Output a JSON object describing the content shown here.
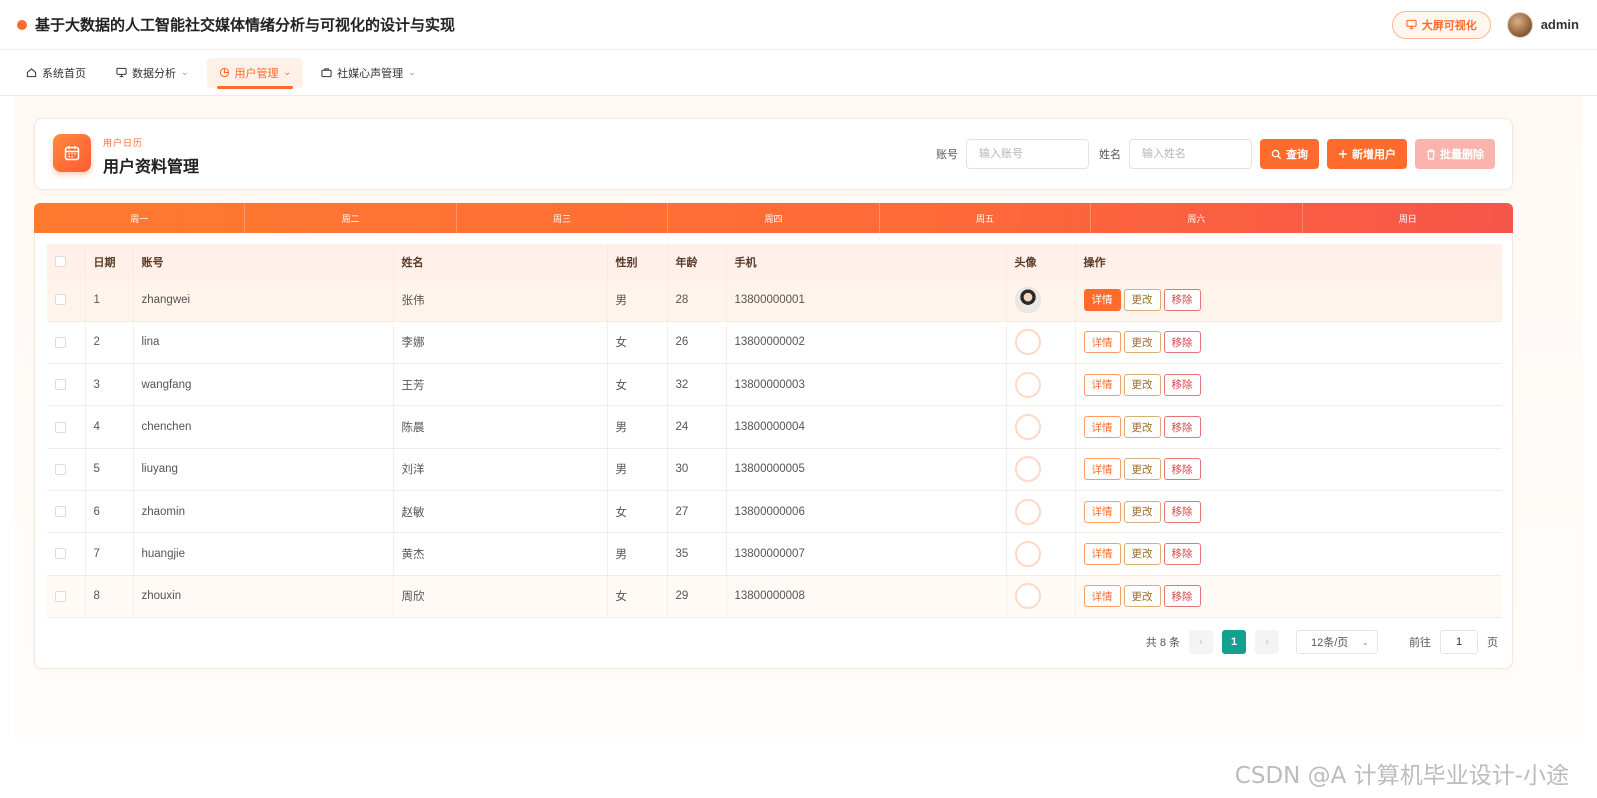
{
  "app": {
    "title": "基于大数据的人工智能社交媒体情绪分析与可视化的设计与实现",
    "bigscreen_label": "大屏可视化",
    "user_name": "admin"
  },
  "nav": {
    "items": [
      {
        "label": "系统首页"
      },
      {
        "label": "数据分析"
      },
      {
        "label": "用户管理"
      },
      {
        "label": "社媒心声管理"
      }
    ]
  },
  "header": {
    "subtitle": "用户日历",
    "title": "用户资料管理"
  },
  "search": {
    "account_label": "账号",
    "account_placeholder": "输入账号",
    "name_label": "姓名",
    "name_placeholder": "输入姓名",
    "query_label": "查询",
    "add_label": "新增用户",
    "batch_delete_label": "批量删除"
  },
  "week": [
    "周一",
    "周二",
    "周三",
    "周四",
    "周五",
    "周六",
    "周日"
  ],
  "table": {
    "columns": [
      "日期",
      "账号",
      "姓名",
      "性别",
      "年龄",
      "手机",
      "头像",
      "操作"
    ],
    "rows": [
      {
        "no": "1",
        "account": "zhangwei",
        "name": "张伟",
        "gender": "男",
        "age": "28",
        "phone": "13800000001"
      },
      {
        "no": "2",
        "account": "lina",
        "name": "李娜",
        "gender": "女",
        "age": "26",
        "phone": "13800000002"
      },
      {
        "no": "3",
        "account": "wangfang",
        "name": "王芳",
        "gender": "女",
        "age": "32",
        "phone": "13800000003"
      },
      {
        "no": "4",
        "account": "chenchen",
        "name": "陈晨",
        "gender": "男",
        "age": "24",
        "phone": "13800000004"
      },
      {
        "no": "5",
        "account": "liuyang",
        "name": "刘洋",
        "gender": "男",
        "age": "30",
        "phone": "13800000005"
      },
      {
        "no": "6",
        "account": "zhaomin",
        "name": "赵敏",
        "gender": "女",
        "age": "27",
        "phone": "13800000006"
      },
      {
        "no": "7",
        "account": "huangjie",
        "name": "黄杰",
        "gender": "男",
        "age": "35",
        "phone": "13800000007"
      },
      {
        "no": "8",
        "account": "zhouxin",
        "name": "周欣",
        "gender": "女",
        "age": "29",
        "phone": "13800000008"
      }
    ],
    "actions": {
      "detail": "详情",
      "edit": "更改",
      "remove": "移除"
    }
  },
  "pagination": {
    "total": "共 8 条",
    "current": "1",
    "page_size": "12条/页",
    "goto_label": "前往",
    "goto_value": "1",
    "page_suffix": "页"
  },
  "watermark": "CSDN @A 计算机毕业设计-小途",
  "colors": {
    "accent": "#ff6b2c",
    "pager_active": "#14a08f"
  }
}
